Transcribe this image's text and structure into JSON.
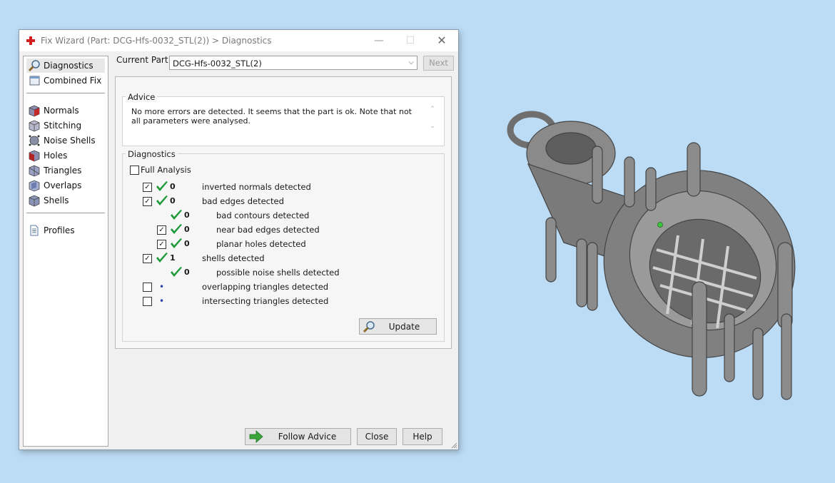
{
  "window": {
    "title": "Fix Wizard (Part: DCG-Hfs-0032_STL(2)) > Diagnostics",
    "icon": "red-cross-icon",
    "controls": {
      "minimize": "—",
      "maximize": "☐",
      "close": "✕"
    }
  },
  "nav": {
    "top_items": [
      {
        "label": "Diagnostics",
        "icon": "magnifier-icon",
        "selected": true
      },
      {
        "label": "Combined Fix",
        "icon": "combined-fix-icon"
      }
    ],
    "fix_items": [
      {
        "label": "Normals",
        "icon": "normals-cube-icon"
      },
      {
        "label": "Stitching",
        "icon": "stitching-icon"
      },
      {
        "label": "Noise Shells",
        "icon": "noise-shells-icon"
      },
      {
        "label": "Holes",
        "icon": "holes-cube-icon"
      },
      {
        "label": "Triangles",
        "icon": "triangles-icon"
      },
      {
        "label": "Overlaps",
        "icon": "overlaps-icon"
      },
      {
        "label": "Shells",
        "icon": "shells-icon"
      }
    ],
    "bottom_items": [
      {
        "label": "Profiles",
        "icon": "document-icon"
      }
    ]
  },
  "current_part": {
    "label": "Current Part:",
    "value": "DCG-Hfs-0032_STL(2)",
    "next_label": "Next"
  },
  "advice": {
    "title": "Advice",
    "text": "No more errors are detected. It seems that the part is ok. Note that not all parameters were analysed."
  },
  "diagnostics": {
    "title": "Diagnostics",
    "full_analysis": {
      "label": "Full Analysis",
      "checked": false
    },
    "rows": [
      {
        "indent": 0,
        "checkbox": true,
        "checked": true,
        "status": "ok",
        "count": "0",
        "label": "inverted normals detected"
      },
      {
        "indent": 0,
        "checkbox": true,
        "checked": true,
        "status": "ok",
        "count": "0",
        "label": "bad edges detected"
      },
      {
        "indent": 2,
        "checkbox": false,
        "checked": false,
        "status": "ok",
        "count": "0",
        "label": "bad contours detected"
      },
      {
        "indent": 1,
        "checkbox": true,
        "checked": true,
        "status": "ok",
        "count": "0",
        "label": "near bad edges detected"
      },
      {
        "indent": 1,
        "checkbox": true,
        "checked": true,
        "status": "ok",
        "count": "0",
        "label": "planar holes detected"
      },
      {
        "indent": 0,
        "checkbox": true,
        "checked": true,
        "status": "ok",
        "count": "1",
        "label": "shells detected"
      },
      {
        "indent": 2,
        "checkbox": false,
        "checked": false,
        "status": "ok",
        "count": "0",
        "label": "possible noise shells detected"
      },
      {
        "indent": 0,
        "checkbox": true,
        "checked": false,
        "status": "pending",
        "count": "",
        "label": "overlapping triangles detected"
      },
      {
        "indent": 0,
        "checkbox": true,
        "checked": false,
        "status": "pending",
        "count": "",
        "label": "intersecting triangles detected"
      }
    ],
    "update_label": "Update"
  },
  "buttons": {
    "follow_advice": "Follow Advice",
    "close": "Close",
    "help": "Help"
  },
  "colors": {
    "desktop": "#bcdcf6",
    "check_green": "#1f9a3a",
    "model_gray": "#7c7c7c",
    "marker_green": "#3ec43e"
  }
}
